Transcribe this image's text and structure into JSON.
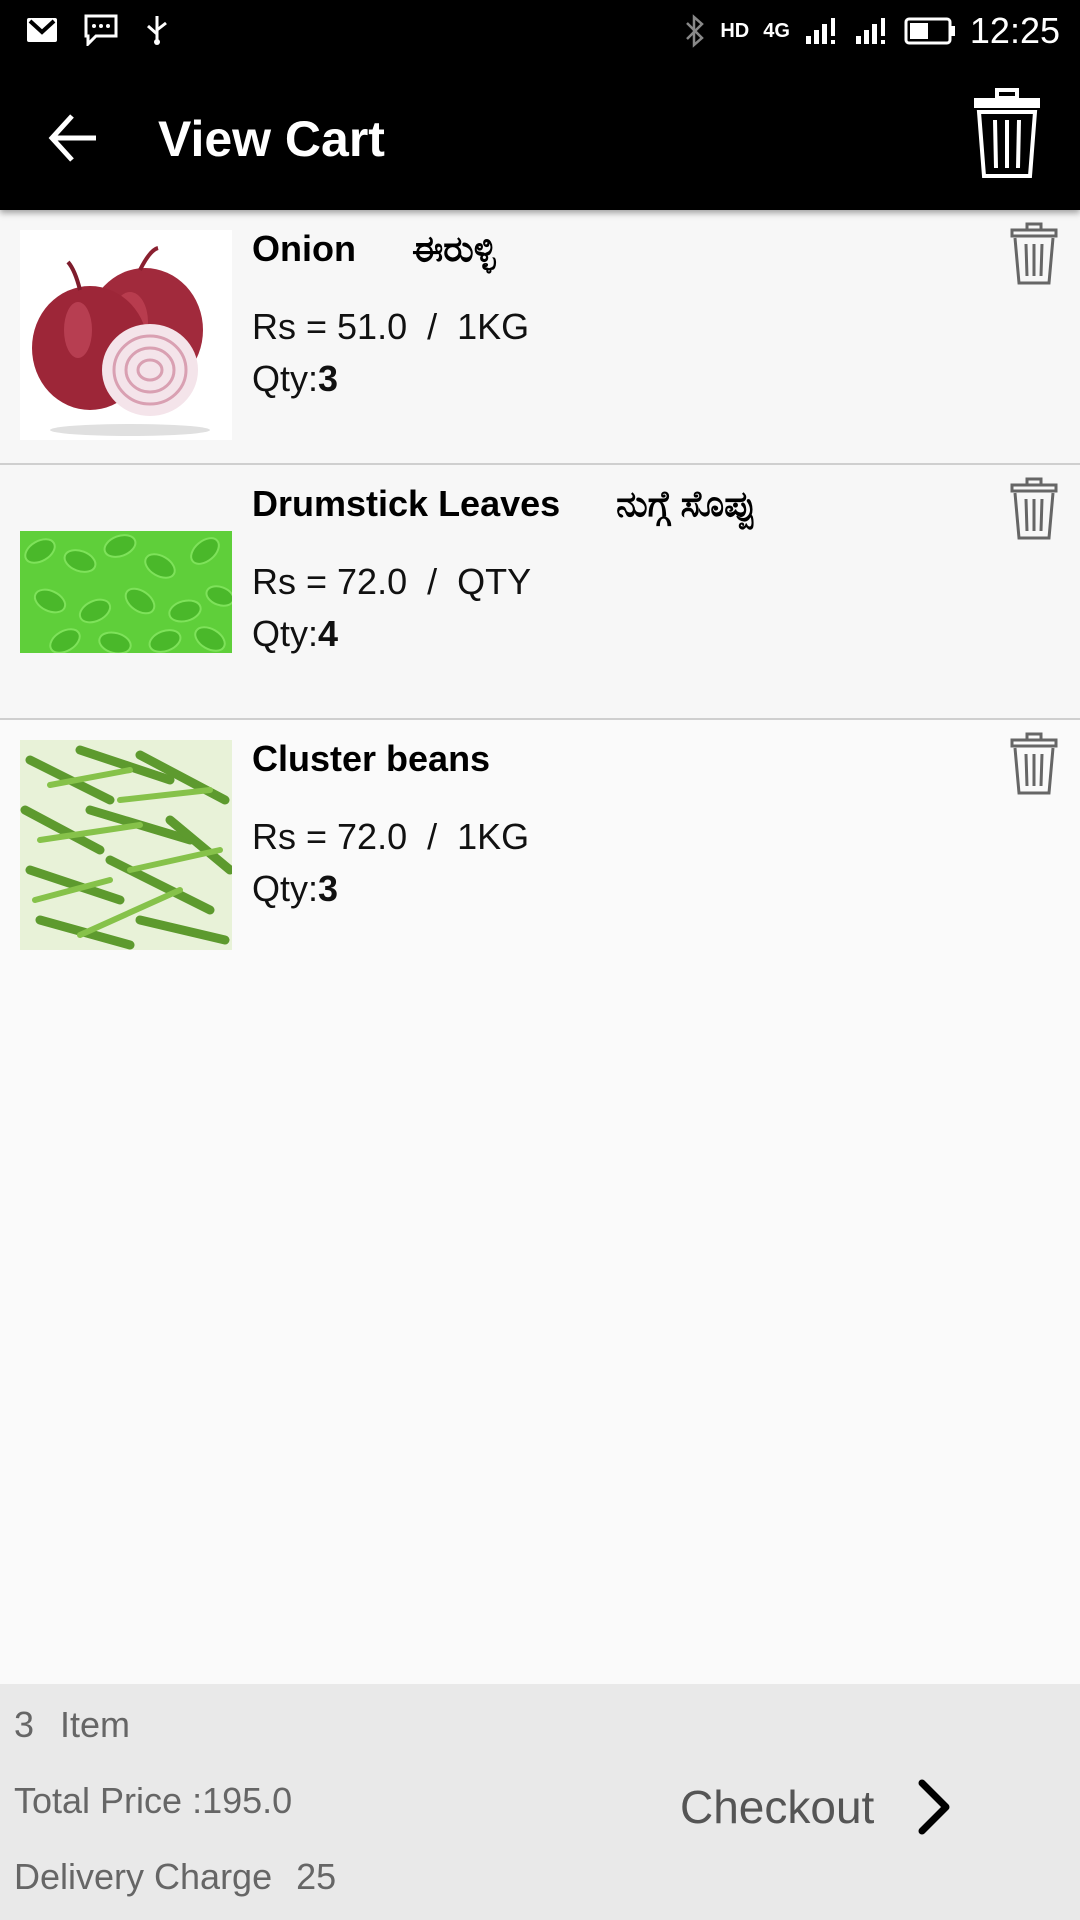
{
  "status_bar": {
    "time": "12:25",
    "network": "4G",
    "hd": "HD",
    "icons": [
      "gmail-icon",
      "message-icon",
      "usb-icon",
      "bluetooth-icon",
      "hd-call-icon",
      "signal-icon",
      "signal-icon-2",
      "battery-icon"
    ]
  },
  "app_bar": {
    "title": "View Cart",
    "back_icon": "arrow-left-icon",
    "clear_icon": "trash-icon"
  },
  "cart": {
    "items": [
      {
        "name": "Onion",
        "name_local": "ಈರುಳ್ಳಿ",
        "price": "Rs = 51.0  /  1KG",
        "qty_label": "Qty:",
        "qty": "3",
        "image": "onion-image"
      },
      {
        "name": "Drumstick Leaves",
        "name_local": "ನುಗ್ಗೆ ಸೊಪ್ಪು",
        "price": "Rs = 72.0  /  QTY",
        "qty_label": "Qty:",
        "qty": "4",
        "image": "drumstick-leaves-image"
      },
      {
        "name": "Cluster beans",
        "name_local": "",
        "price": "Rs = 72.0  /  1KG",
        "qty_label": "Qty:",
        "qty": "3",
        "image": "cluster-beans-image"
      }
    ]
  },
  "footer": {
    "count": "3",
    "count_label": "Item",
    "total_price": "Total Price :195.0",
    "delivery_label": "Delivery Charge",
    "delivery_value": "25",
    "checkout_label": "Checkout"
  },
  "colors": {
    "app_bar": "#000000",
    "background": "#fafafa",
    "footer": "#e9e9e9",
    "divider": "#cfcfcf"
  }
}
